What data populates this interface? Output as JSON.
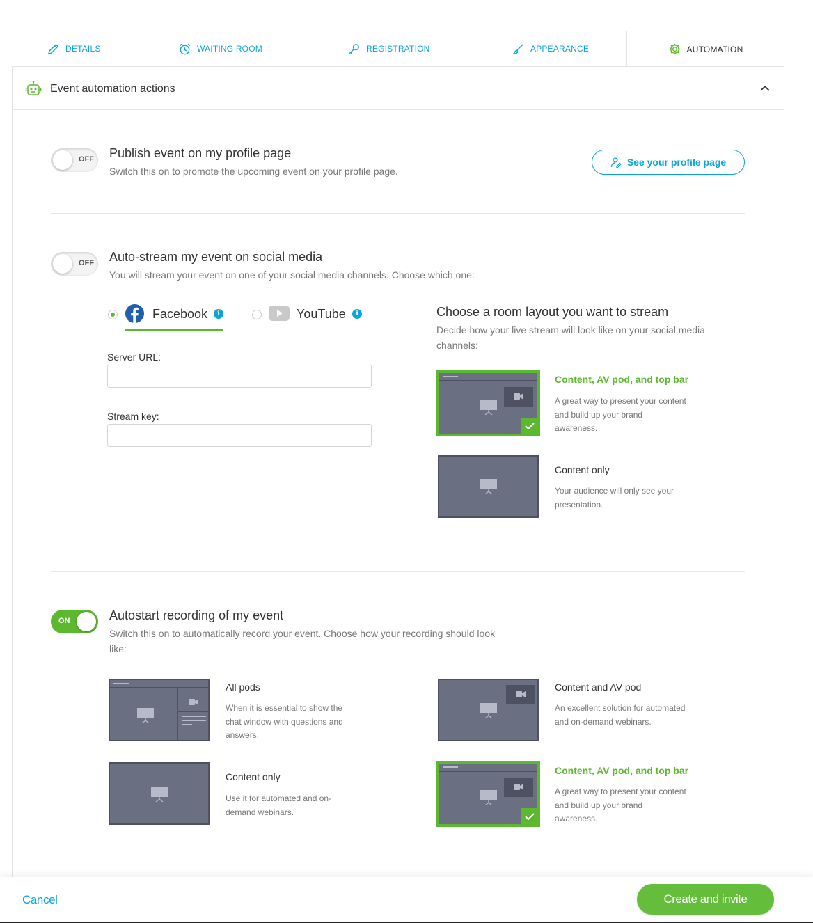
{
  "tabs": [
    {
      "label": "DETAILS",
      "icon": "pencil-icon"
    },
    {
      "label": "WAITING ROOM",
      "icon": "alarm-clock-icon"
    },
    {
      "label": "REGISTRATION",
      "icon": "key-icon"
    },
    {
      "label": "APPEARANCE",
      "icon": "brush-icon"
    },
    {
      "label": "AUTOMATION",
      "icon": "gear-icon",
      "active": true
    }
  ],
  "panel": {
    "title": "Event automation actions"
  },
  "publish": {
    "toggle": "OFF",
    "title": "Publish event on my profile page",
    "subtitle": "Switch this on to promote the upcoming event on your profile page.",
    "button": "See your profile page"
  },
  "autostream": {
    "toggle": "OFF",
    "title": "Auto-stream my event on social media",
    "subtitle": "You will stream your event on one of your social media channels. Choose which one:",
    "networks": [
      {
        "label": "Facebook",
        "selected": true
      },
      {
        "label": "YouTube",
        "selected": false
      }
    ],
    "server_url_label": "Server URL:",
    "server_url_value": "",
    "stream_key_label": "Stream key:",
    "stream_key_value": "",
    "layout_title": "Choose a room layout you want to stream",
    "layout_subtitle": "Decide how your live stream will look like on your social media channels:",
    "layouts": [
      {
        "title": "Content, AV pod, and top bar",
        "desc": "A great way to present your content and build up your brand awareness.",
        "selected": true
      },
      {
        "title": "Content only",
        "desc": "Your audience will only see your presentation.",
        "selected": false
      }
    ]
  },
  "recording": {
    "toggle": "ON",
    "title": "Autostart recording of my event",
    "subtitle": "Switch this on to automatically record your event. Choose how your recording should look like:",
    "layouts": [
      {
        "title": "All pods",
        "desc": "When it is essential to show the chat window with questions and answers.",
        "selected": false
      },
      {
        "title": "Content and AV pod",
        "desc": "An excellent solution for automated and on-demand webinars.",
        "selected": false
      },
      {
        "title": "Content only",
        "desc": "Use it for automated and on-demand webinars.",
        "selected": false
      },
      {
        "title": "Content, AV pod, and top bar",
        "desc": "A great way to present your content and build up your brand awareness.",
        "selected": true
      }
    ]
  },
  "footer": {
    "cancel": "Cancel",
    "primary": "Create and invite"
  },
  "colors": {
    "accent": "#0ba5d8",
    "green": "#5cb82e",
    "thumb": "#6b6f82"
  }
}
